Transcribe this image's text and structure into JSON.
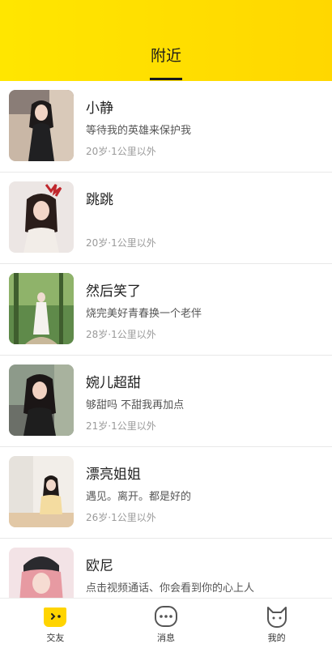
{
  "header": {
    "title": "附近"
  },
  "users": [
    {
      "name": "小静",
      "bio": "等待我的英雄来保护我",
      "meta": "20岁·1公里以外"
    },
    {
      "name": "跳跳",
      "bio": "",
      "meta": "20岁·1公里以外"
    },
    {
      "name": "然后笑了",
      "bio": "烧完美好青春换一个老伴",
      "meta": "28岁·1公里以外"
    },
    {
      "name": "婉儿超甜",
      "bio": "够甜吗 不甜我再加点",
      "meta": "21岁·1公里以外"
    },
    {
      "name": "漂亮姐姐",
      "bio": "遇见。离开。都是好的",
      "meta": "26岁·1公里以外"
    },
    {
      "name": "欧尼",
      "bio": "点击视频通话、你会看到你的心上人",
      "meta": ""
    }
  ],
  "tabbar": {
    "items": [
      {
        "label": "交友",
        "icon": "chat-face-icon",
        "active": true
      },
      {
        "label": "消息",
        "icon": "message-dots-icon",
        "active": false
      },
      {
        "label": "我的",
        "icon": "cat-face-icon",
        "active": false
      }
    ]
  },
  "colors": {
    "accent": "#ffe100",
    "header_gradient_end": "#ffd700"
  }
}
